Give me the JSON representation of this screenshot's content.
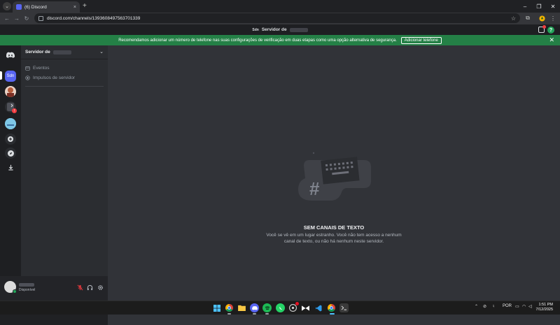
{
  "browser": {
    "tab_title": "(6) Discord",
    "tab_close": "×",
    "new_tab": "+",
    "url": "discord.com/channels/1393608497563701339",
    "window_controls": [
      "⌵",
      "–",
      "❐",
      "✕"
    ]
  },
  "titlebar": {
    "server_icon_text": "Sdn",
    "server_name_prefix": "Servidor de"
  },
  "notice": {
    "text": "Recomendamos adicionar um número de telefone nas suas configurações de verificação em duas etapas como uma opção alternativa de segurança.",
    "button_label": "Adicionar telefone",
    "close": "✕"
  },
  "guilds": {
    "selected_label": "Sdn"
  },
  "sidebar": {
    "server_title": "Servidor de",
    "items": [
      {
        "label": "Eventos",
        "icon": "calendar-icon"
      },
      {
        "label": "Impulsos de servidor",
        "icon": "boost-icon"
      }
    ]
  },
  "user_panel": {
    "status_text": "Disponível"
  },
  "main": {
    "empty_title": "SEM CANAIS DE TEXTO",
    "empty_desc": "Você se vê em um lugar estranho. Você não tem acesso a nenhum canal de texto, ou não há nenhum neste servidor."
  },
  "taskbar": {
    "lang": "POR",
    "time": "1:51 PM",
    "date": "7/12/2025"
  },
  "colors": {
    "discord_blurple": "#5865f2",
    "notice_green": "#248046",
    "status_green": "#23a55a",
    "mute_red": "#da373c"
  }
}
